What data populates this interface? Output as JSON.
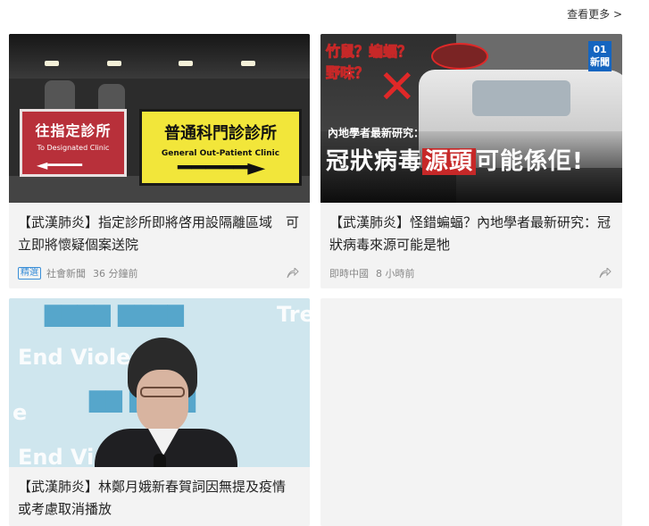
{
  "header": {
    "see_more": "查看更多 >"
  },
  "cards": [
    {
      "title": "【武漢肺炎】指定診所即將啓用設隔離區域　可立即將懷疑個案送院",
      "badge": "精選",
      "source": "社會新聞",
      "time": "36 分鐘前",
      "image": {
        "red_sign_zh": "往指定診所",
        "red_sign_en": "To Designated Clinic",
        "yellow_sign_zh": "普通科門診診所",
        "yellow_sign_en": "General Out-Patient Clinic"
      }
    },
    {
      "title": "【武漢肺炎】怪錯蝙蝠？內地學者最新研究：冠狀病毒來源可能是牠",
      "source": "即時中國",
      "time": "8 小時前",
      "image": {
        "question_line1": "竹鼠？蝙蝠？",
        "question_line2": "野味？",
        "logo": "01\n新聞",
        "subtitle": "內地學者最新研究：",
        "headline_a": "冠狀病毒",
        "headline_b": "源頭",
        "headline_c": "可能係佢!"
      }
    },
    {
      "title": "【武漢肺炎】林鄭月娥新春賀詞因無提及疫情　或考慮取消播放",
      "image": {
        "bg_line1": "End Violence",
        "bg_line2": "End Violence",
        "bg_side": "Tre",
        "bg_e": "e"
      }
    }
  ],
  "icons": {
    "share": "share-icon"
  }
}
